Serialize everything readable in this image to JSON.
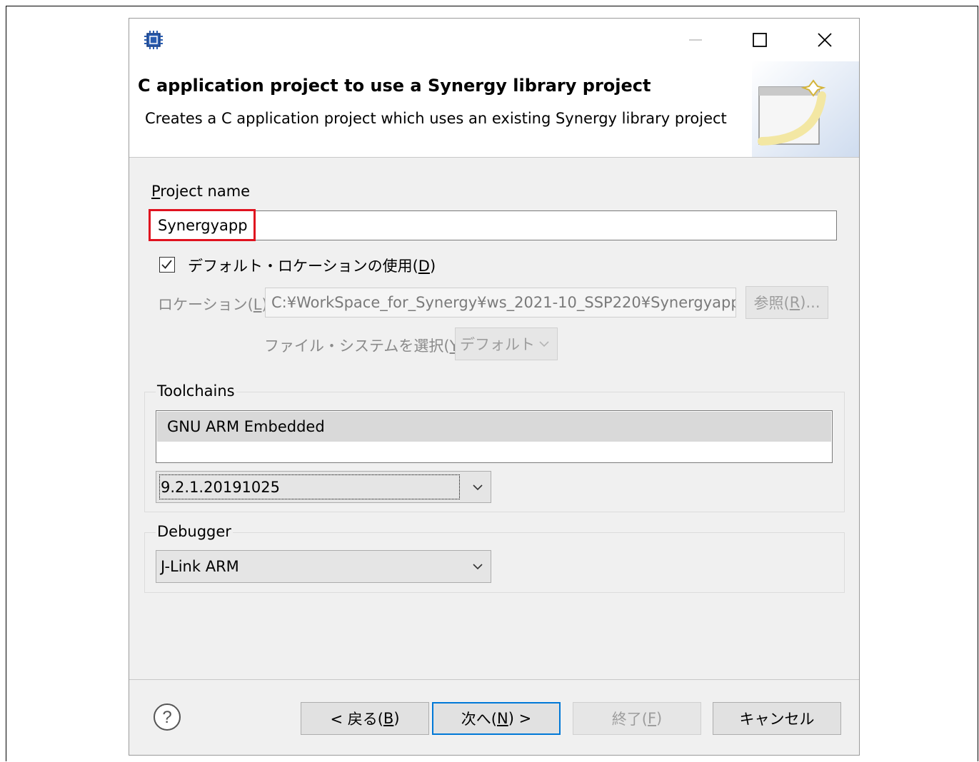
{
  "dialog": {
    "banner_title": "C application project to use a Synergy library project",
    "banner_description": "Creates a C application project which uses an existing Synergy library project"
  },
  "project_name": {
    "label_prefix": "P",
    "label_rest": "roject name",
    "value": "Synergyapp"
  },
  "default_location": {
    "label": "デフォルト・ロケーションの使用(",
    "accel": "D",
    "label_suffix": ")",
    "checked": true
  },
  "location": {
    "label": "ロケーション(",
    "accel": "L",
    "label_suffix": "):",
    "value": "C:¥WorkSpace_for_Synergy¥ws_2021-10_SSP220¥Synergyapp",
    "browse_label": "参照(",
    "browse_accel": "R",
    "browse_suffix": ")..."
  },
  "filesystem": {
    "label": "ファイル・システムを選択(",
    "accel": "Y",
    "label_suffix": "):",
    "value": "デフォルト"
  },
  "toolchains": {
    "title": "Toolchains",
    "items": [
      "GNU ARM Embedded"
    ],
    "version": "9.2.1.20191025"
  },
  "debugger": {
    "title": "Debugger",
    "value": "J-Link ARM"
  },
  "buttons": {
    "back": "< 戻る(",
    "back_accel": "B",
    "back_suffix": ")",
    "next": "次へ(",
    "next_accel": "N",
    "next_suffix": ") >",
    "finish": "終了(",
    "finish_accel": "F",
    "finish_suffix": ")",
    "cancel": "キャンセル"
  },
  "colors": {
    "highlight": "#e0121f",
    "default_button_border": "#0078d7",
    "dialog_bg": "#f0f0f0"
  },
  "icons": [
    "app-chip-icon",
    "minimize-icon",
    "maximize-icon",
    "close-icon",
    "wizard-banner-icon",
    "checkmark-icon",
    "chevron-down-icon",
    "help-icon"
  ]
}
